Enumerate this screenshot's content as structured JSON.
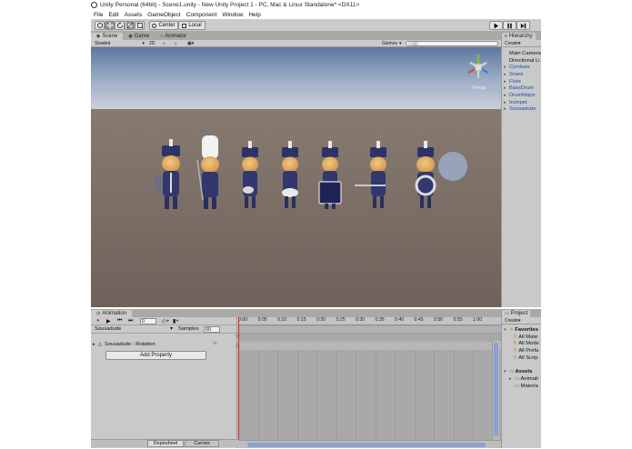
{
  "window": {
    "title": "Unity Personal (64bit) - Scene1.unity - New Unity Project 1 - PC, Mac & Linux Standalone* <DX11>"
  },
  "menu": [
    "File",
    "Edit",
    "Assets",
    "GameObject",
    "Component",
    "Window",
    "Help"
  ],
  "toolbar": {
    "center_label": "Center",
    "local_label": "Local"
  },
  "scene": {
    "tabs": [
      "Scene",
      "Game",
      "Animator"
    ],
    "shading_mode": "Shaded",
    "mode_2d": "2D",
    "gizmos_label": "Gizmos",
    "search_placeholder": "ⓠAll",
    "persp_label": "Persp",
    "colors": {
      "sky_top": "#5f7aa3",
      "sky_horizon": "#c9cfd8",
      "ground": "#7d6d64",
      "uniform": "#32386e"
    }
  },
  "hierarchy": {
    "title": "Hierarchy",
    "create_label": "Create",
    "items": [
      {
        "label": "Main Camera",
        "prefab": false
      },
      {
        "label": "Directional Li",
        "prefab": false
      },
      {
        "label": "Cymbals",
        "prefab": true
      },
      {
        "label": "Snare",
        "prefab": true
      },
      {
        "label": "Flute",
        "prefab": true
      },
      {
        "label": "BassDrum",
        "prefab": true
      },
      {
        "label": "DrumMajor",
        "prefab": true
      },
      {
        "label": "trumpet",
        "prefab": true
      },
      {
        "label": "Sousadude",
        "prefab": true
      }
    ]
  },
  "animation": {
    "title": "Animation",
    "frame": "0",
    "clip": "Sousadude",
    "samples_label": "Samples",
    "samples": "60",
    "property": "Sousadude : Rotation",
    "add_property": "Add Property",
    "dopesheet_label": "Dopesheet",
    "curves_label": "Curves",
    "ticks": [
      "0:00",
      "0:05",
      "0:10",
      "0:15",
      "0:20",
      "0:25",
      "0:30",
      "0:35",
      "0:40",
      "0:45",
      "0:50",
      "0:55",
      "1:00"
    ]
  },
  "project": {
    "title": "Project",
    "create_label": "Create",
    "favorites_label": "Favorites",
    "favorites": [
      "All Mate",
      "All Mode",
      "All Prefa",
      "All Scrip"
    ],
    "assets_label": "Assets",
    "assets": [
      "Animati",
      "Materia"
    ]
  }
}
